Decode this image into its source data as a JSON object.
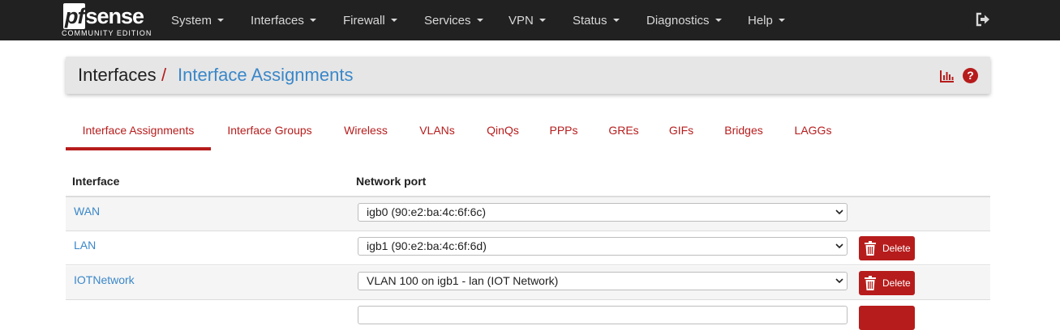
{
  "brand": {
    "logo": "pfsense",
    "edition": "COMMUNITY EDITION"
  },
  "nav": {
    "items": [
      {
        "label": "System"
      },
      {
        "label": "Interfaces"
      },
      {
        "label": "Firewall"
      },
      {
        "label": "Services"
      },
      {
        "label": "VPN"
      },
      {
        "label": "Status"
      },
      {
        "label": "Diagnostics"
      },
      {
        "label": "Help"
      }
    ],
    "logout_icon": "sign-out-icon"
  },
  "breadcrumb": {
    "root": "Interfaces",
    "separator": "/",
    "current": "Interface Assignments"
  },
  "header_icons": {
    "chart": "bar-chart-icon",
    "help": "question-circle-icon",
    "help_glyph": "?"
  },
  "tabs": [
    {
      "label": "Interface Assignments",
      "active": true
    },
    {
      "label": "Interface Groups"
    },
    {
      "label": "Wireless"
    },
    {
      "label": "VLANs"
    },
    {
      "label": "QinQs"
    },
    {
      "label": "PPPs"
    },
    {
      "label": "GREs"
    },
    {
      "label": "GIFs"
    },
    {
      "label": "Bridges"
    },
    {
      "label": "LAGGs"
    }
  ],
  "table": {
    "headers": {
      "interface": "Interface",
      "port": "Network port"
    },
    "rows": [
      {
        "interface": "WAN",
        "port": "igb0 (90:e2:ba:4c:6f:6c)"
      },
      {
        "interface": "LAN",
        "port": "igb1 (90:e2:ba:4c:6f:6d)",
        "action": "Delete"
      },
      {
        "interface": "IOTNetwork",
        "port": "VLAN 100 on igb1 - lan (IOT Network)",
        "action": "Delete"
      }
    ]
  },
  "colors": {
    "navbar": "#212121",
    "accent": "#b71c1c",
    "link": "#3a87c9"
  }
}
